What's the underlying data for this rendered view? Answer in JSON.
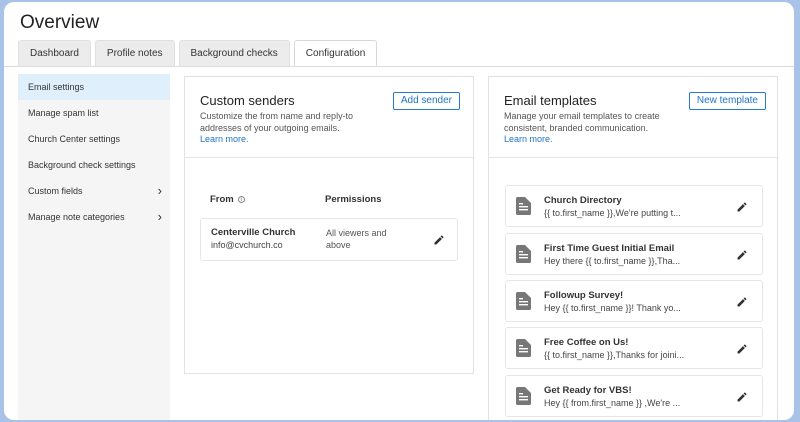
{
  "page": {
    "title": "Overview"
  },
  "tabs": [
    {
      "label": "Dashboard"
    },
    {
      "label": "Profile notes"
    },
    {
      "label": "Background checks"
    },
    {
      "label": "Configuration"
    }
  ],
  "sidebar": {
    "items": [
      {
        "label": "Email settings"
      },
      {
        "label": "Manage spam list"
      },
      {
        "label": "Church Center settings"
      },
      {
        "label": "Background check settings"
      },
      {
        "label": "Custom fields",
        "chevron": "›"
      },
      {
        "label": "Manage note categories",
        "chevron": "›"
      }
    ]
  },
  "senders": {
    "title": "Custom senders",
    "description": "Customize the from name and reply-to addresses of your outgoing emails.",
    "learn_more": "Learn more.",
    "add_button": "Add sender",
    "col_from": "From",
    "col_permissions": "Permissions",
    "info_glyph": "i",
    "rows": [
      {
        "name": "Centerville Church",
        "email": "info@cvchurch.co",
        "permissions": "All viewers and above"
      }
    ]
  },
  "templates": {
    "title": "Email templates",
    "description": "Manage your email templates to create consistent, branded communication.",
    "learn_more": "Learn more.",
    "new_button": "New template",
    "items": [
      {
        "name": "Church Directory",
        "preview": "{{ to.first_name }},We're putting t..."
      },
      {
        "name": "First Time Guest Initial Email",
        "preview": "Hey there {{ to.first_name }},Tha..."
      },
      {
        "name": "Followup Survey!",
        "preview": "Hey {{ to.first_name }}! Thank yo..."
      },
      {
        "name": "Free Coffee on Us!",
        "preview": "{{ to.first_name }},Thanks for joini..."
      },
      {
        "name": "Get Ready for VBS!",
        "preview": "Hey {{ from.first_name }} ,We're ..."
      }
    ]
  },
  "colors": {
    "accent": "#1f74c8",
    "active_sidebar": "#dfeffc",
    "frame": "#a9c3e8"
  }
}
